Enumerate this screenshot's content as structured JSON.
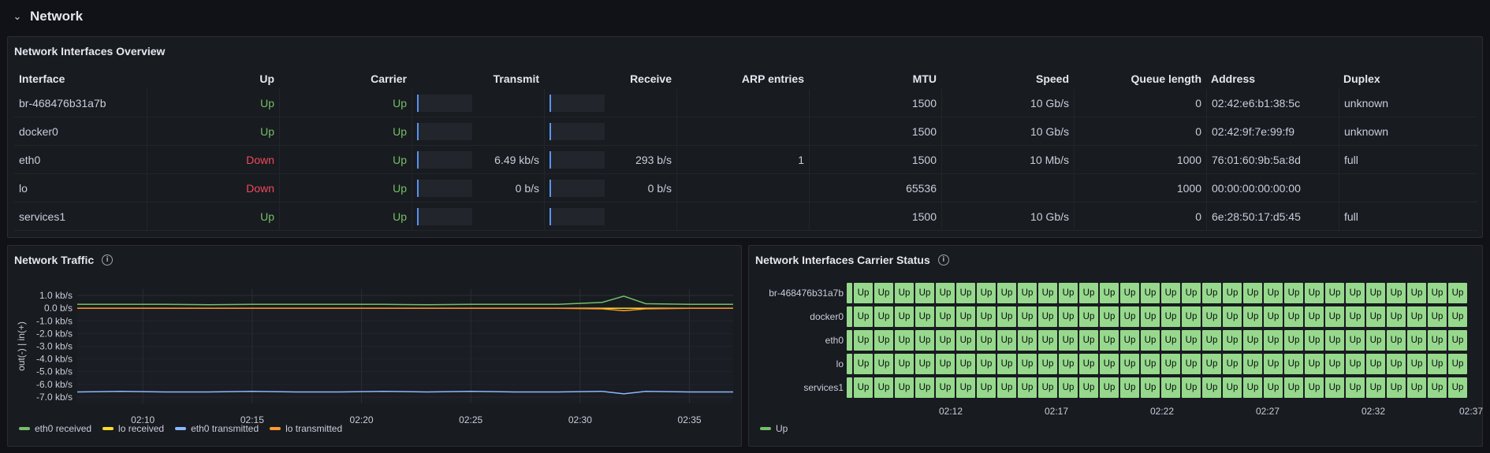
{
  "row": {
    "title": "Network",
    "collapse_icon": "chevron-down-icon"
  },
  "overview": {
    "title": "Network Interfaces Overview",
    "columns": [
      "Interface",
      "Up",
      "Carrier",
      "Transmit",
      "Receive",
      "ARP entries",
      "MTU",
      "Speed",
      "Queue length",
      "Address",
      "Duplex"
    ],
    "rows": [
      {
        "interface": "br-468476b31a7b",
        "up": "Up",
        "carrier": "Up",
        "transmit": "",
        "receive": "",
        "arp": "",
        "mtu": "1500",
        "speed": "10 Gb/s",
        "queue": "0",
        "address": "02:42:e6:b1:38:5c",
        "duplex": "unknown"
      },
      {
        "interface": "docker0",
        "up": "Up",
        "carrier": "Up",
        "transmit": "",
        "receive": "",
        "arp": "",
        "mtu": "1500",
        "speed": "10 Gb/s",
        "queue": "0",
        "address": "02:42:9f:7e:99:f9",
        "duplex": "unknown"
      },
      {
        "interface": "eth0",
        "up": "Down",
        "carrier": "Up",
        "transmit": "6.49 kb/s",
        "receive": "293 b/s",
        "arp": "1",
        "mtu": "1500",
        "speed": "10 Mb/s",
        "queue": "1000",
        "address": "76:01:60:9b:5a:8d",
        "duplex": "full"
      },
      {
        "interface": "lo",
        "up": "Down",
        "carrier": "Up",
        "transmit": "0 b/s",
        "receive": "0 b/s",
        "arp": "",
        "mtu": "65536",
        "speed": "",
        "queue": "1000",
        "address": "00:00:00:00:00:00",
        "duplex": ""
      },
      {
        "interface": "services1",
        "up": "Up",
        "carrier": "Up",
        "transmit": "",
        "receive": "",
        "arp": "",
        "mtu": "1500",
        "speed": "10 Gb/s",
        "queue": "0",
        "address": "6e:28:50:17:d5:45",
        "duplex": "full"
      }
    ],
    "colors": {
      "up": "#73bf69",
      "down": "#f2495c",
      "gauge": "#5794f2"
    }
  },
  "traffic": {
    "title": "Network Traffic",
    "info_icon": "info-icon",
    "chart_data": {
      "type": "line",
      "ylabel": "out(-) | in(+)",
      "ylim": [
        -7.5,
        1.5
      ],
      "y_ticks": [
        "1.0 kb/s",
        "0.0 b/s",
        "-1.0 kb/s",
        "-2.0 kb/s",
        "-3.0 kb/s",
        "-4.0 kb/s",
        "-5.0 kb/s",
        "-6.0 kb/s",
        "-7.0 kb/s"
      ],
      "y_tick_values": [
        1,
        0,
        -1,
        -2,
        -3,
        -4,
        -5,
        -6,
        -7
      ],
      "x_ticks": [
        "02:10",
        "02:15",
        "02:20",
        "02:25",
        "02:30",
        "02:35"
      ],
      "x": [
        "02:07",
        "02:09",
        "02:11",
        "02:13",
        "02:15",
        "02:17",
        "02:19",
        "02:21",
        "02:23",
        "02:25",
        "02:27",
        "02:29",
        "02:31",
        "02:32",
        "02:33",
        "02:35",
        "02:37"
      ],
      "grid": true,
      "series": [
        {
          "name": "eth0 received",
          "color": "#73bf69",
          "values": [
            0.3,
            0.3,
            0.3,
            0.28,
            0.3,
            0.3,
            0.3,
            0.3,
            0.28,
            0.3,
            0.3,
            0.3,
            0.45,
            0.95,
            0.35,
            0.3,
            0.3
          ]
        },
        {
          "name": "lo received",
          "color": "#fade2a",
          "values": [
            0,
            0,
            0,
            0,
            0,
            0,
            0,
            0,
            0,
            0,
            0,
            0,
            0,
            0,
            0,
            0,
            0
          ]
        },
        {
          "name": "eth0 transmitted",
          "color": "#8ab8ff",
          "values": [
            -6.6,
            -6.55,
            -6.6,
            -6.6,
            -6.55,
            -6.6,
            -6.6,
            -6.55,
            -6.6,
            -6.55,
            -6.6,
            -6.6,
            -6.55,
            -6.75,
            -6.55,
            -6.6,
            -6.6
          ]
        },
        {
          "name": "lo transmitted",
          "color": "#ff9830",
          "values": [
            0,
            0,
            0,
            0,
            0,
            0,
            0,
            0,
            0,
            0,
            0,
            0,
            -0.05,
            -0.2,
            -0.05,
            0,
            0
          ]
        }
      ]
    }
  },
  "carrier": {
    "title": "Network Interfaces Carrier Status",
    "info_icon": "info-icon",
    "chart_data": {
      "type": "heatmap",
      "rows": [
        "br-468476b31a7b",
        "docker0",
        "eth0",
        "lo",
        "services1"
      ],
      "cell_value": "Up",
      "columns": 30,
      "x_ticks": [
        "02:12",
        "02:17",
        "02:22",
        "02:27",
        "02:32",
        "02:37"
      ],
      "legend": [
        "Up"
      ],
      "color": "#96d98d"
    }
  }
}
